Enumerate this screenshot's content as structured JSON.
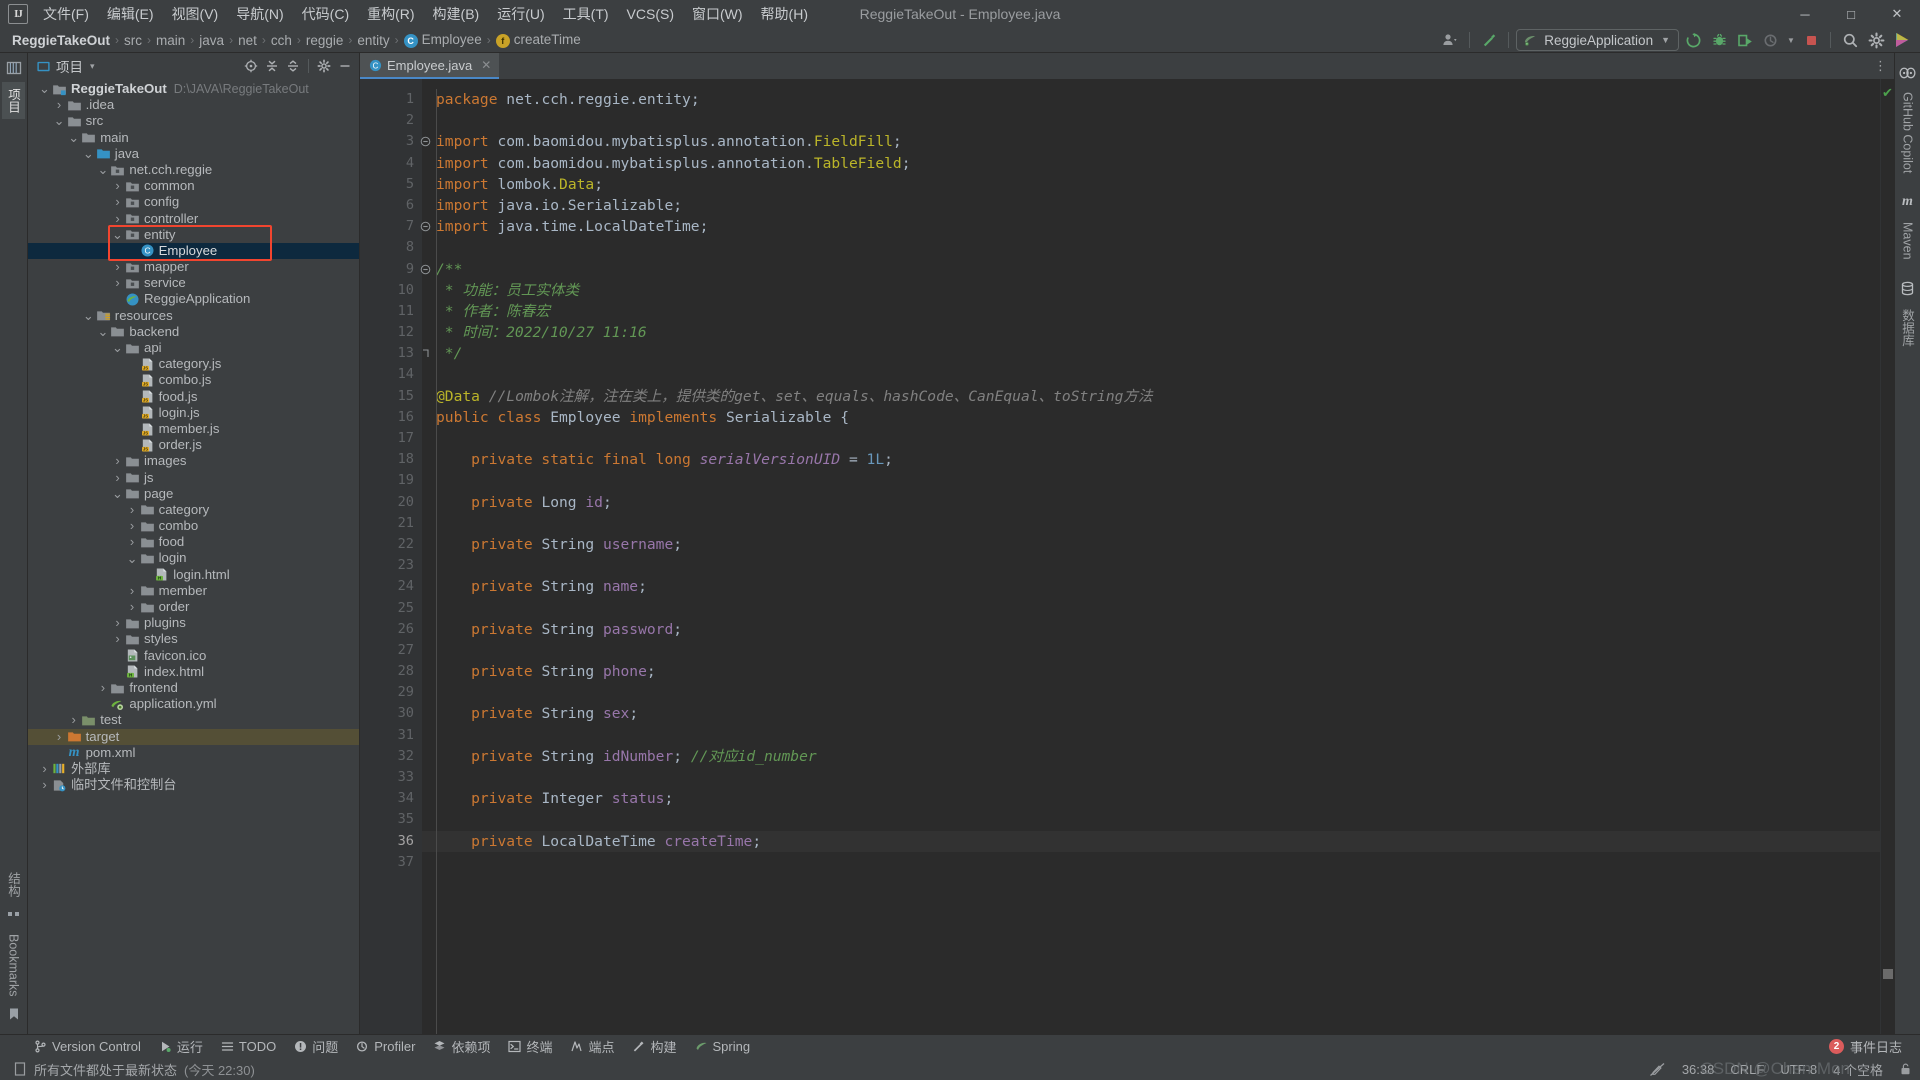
{
  "window": {
    "title": "ReggieTakeOut - Employee.java",
    "logo": "intellij-idea-logo",
    "minimize": "─",
    "maximize": "□",
    "close": "✕"
  },
  "menubar": {
    "items": [
      {
        "label": "文件(F)"
      },
      {
        "label": "编辑(E)"
      },
      {
        "label": "视图(V)"
      },
      {
        "label": "导航(N)"
      },
      {
        "label": "代码(C)"
      },
      {
        "label": "重构(R)"
      },
      {
        "label": "构建(B)"
      },
      {
        "label": "运行(U)"
      },
      {
        "label": "工具(T)"
      },
      {
        "label": "VCS(S)"
      },
      {
        "label": "窗口(W)"
      },
      {
        "label": "帮助(H)"
      }
    ]
  },
  "breadcrumb": {
    "items": [
      {
        "label": "ReggieTakeOut",
        "bold": true,
        "icon": null
      },
      {
        "label": "src",
        "bold": false,
        "icon": null
      },
      {
        "label": "main",
        "bold": false,
        "icon": null
      },
      {
        "label": "java",
        "bold": false,
        "icon": null
      },
      {
        "label": "net",
        "bold": false,
        "icon": null
      },
      {
        "label": "cch",
        "bold": false,
        "icon": null
      },
      {
        "label": "reggie",
        "bold": false,
        "icon": null
      },
      {
        "label": "entity",
        "bold": false,
        "icon": null
      },
      {
        "label": "Employee",
        "bold": false,
        "icon": "class-icon",
        "glyph": "C"
      },
      {
        "label": "createTime",
        "bold": false,
        "icon": "field-icon",
        "glyph": "f"
      }
    ],
    "separator": "›"
  },
  "toolbar": {
    "account_icon": "user-account-icon",
    "hammer_icon": "build-hammer-icon",
    "run_config": "ReggieApplication",
    "run_config_icon": "spring-boot-icon",
    "rerun_icon": "rerun-icon",
    "debug_icon": "debug-bug-icon",
    "run_with_coverage_icon": "run-coverage-icon",
    "profile_icon": "profiler-icon",
    "stop_icon": "stop-icon",
    "search_icon": "search-everywhere-icon",
    "settings_icon": "settings-gear-icon",
    "updates_icon": "ide-updates-icon"
  },
  "left_rail": {
    "project_tab": "项目",
    "structure_tab": "结构",
    "bookmarks_tab": "Bookmarks"
  },
  "right_rail": {
    "tabs": [
      {
        "label": "GitHub Copilot",
        "icon": "copilot-icon"
      },
      {
        "label": "Maven",
        "icon": "maven-m-icon"
      },
      {
        "label": "数据库",
        "icon": "database-icon"
      }
    ]
  },
  "project_panel": {
    "title": "项目",
    "caret": "▾",
    "icons": {
      "select_opened_file": "crosshair-target-icon",
      "expand_all": "expand-all-icon",
      "collapse_all": "collapse-all-icon",
      "settings": "gear-icon",
      "hide": "minimize-icon"
    },
    "tree": [
      {
        "depth": 0,
        "arrow": "open",
        "icon": "module-folder",
        "label": "ReggieTakeOut",
        "bold": true,
        "path": "D:\\JAVA\\ReggieTakeOut"
      },
      {
        "depth": 1,
        "arrow": "closed",
        "icon": "folder",
        "label": ".idea"
      },
      {
        "depth": 1,
        "arrow": "open",
        "icon": "folder",
        "label": "src"
      },
      {
        "depth": 2,
        "arrow": "open",
        "icon": "folder",
        "label": "main"
      },
      {
        "depth": 3,
        "arrow": "open",
        "icon": "source-folder",
        "label": "java"
      },
      {
        "depth": 4,
        "arrow": "open",
        "icon": "package",
        "label": "net.cch.reggie"
      },
      {
        "depth": 5,
        "arrow": "closed",
        "icon": "package",
        "label": "common"
      },
      {
        "depth": 5,
        "arrow": "closed",
        "icon": "package",
        "label": "config"
      },
      {
        "depth": 5,
        "arrow": "closed",
        "icon": "package",
        "label": "controller"
      },
      {
        "depth": 5,
        "arrow": "open",
        "icon": "package",
        "label": "entity"
      },
      {
        "depth": 6,
        "arrow": "none",
        "icon": "java-class",
        "label": "Employee",
        "selected": true
      },
      {
        "depth": 5,
        "arrow": "closed",
        "icon": "package",
        "label": "mapper"
      },
      {
        "depth": 5,
        "arrow": "closed",
        "icon": "package",
        "label": "service"
      },
      {
        "depth": 5,
        "arrow": "none",
        "icon": "spring-class",
        "label": "ReggieApplication"
      },
      {
        "depth": 3,
        "arrow": "open",
        "icon": "resources-folder",
        "label": "resources"
      },
      {
        "depth": 4,
        "arrow": "open",
        "icon": "folder",
        "label": "backend"
      },
      {
        "depth": 5,
        "arrow": "open",
        "icon": "folder",
        "label": "api"
      },
      {
        "depth": 6,
        "arrow": "none",
        "icon": "js-file",
        "label": "category.js"
      },
      {
        "depth": 6,
        "arrow": "none",
        "icon": "js-file",
        "label": "combo.js"
      },
      {
        "depth": 6,
        "arrow": "none",
        "icon": "js-file",
        "label": "food.js"
      },
      {
        "depth": 6,
        "arrow": "none",
        "icon": "js-file",
        "label": "login.js"
      },
      {
        "depth": 6,
        "arrow": "none",
        "icon": "js-file",
        "label": "member.js"
      },
      {
        "depth": 6,
        "arrow": "none",
        "icon": "js-file",
        "label": "order.js"
      },
      {
        "depth": 5,
        "arrow": "closed",
        "icon": "folder",
        "label": "images"
      },
      {
        "depth": 5,
        "arrow": "closed",
        "icon": "folder",
        "label": "js"
      },
      {
        "depth": 5,
        "arrow": "open",
        "icon": "folder",
        "label": "page"
      },
      {
        "depth": 6,
        "arrow": "closed",
        "icon": "folder",
        "label": "category"
      },
      {
        "depth": 6,
        "arrow": "closed",
        "icon": "folder",
        "label": "combo"
      },
      {
        "depth": 6,
        "arrow": "closed",
        "icon": "folder",
        "label": "food"
      },
      {
        "depth": 6,
        "arrow": "open",
        "icon": "folder",
        "label": "login"
      },
      {
        "depth": 7,
        "arrow": "none",
        "icon": "html-file",
        "label": "login.html"
      },
      {
        "depth": 6,
        "arrow": "closed",
        "icon": "folder",
        "label": "member"
      },
      {
        "depth": 6,
        "arrow": "closed",
        "icon": "folder",
        "label": "order"
      },
      {
        "depth": 5,
        "arrow": "closed",
        "icon": "folder",
        "label": "plugins"
      },
      {
        "depth": 5,
        "arrow": "closed",
        "icon": "folder",
        "label": "styles"
      },
      {
        "depth": 5,
        "arrow": "none",
        "icon": "image-file",
        "label": "favicon.ico"
      },
      {
        "depth": 5,
        "arrow": "none",
        "icon": "html-file",
        "label": "index.html"
      },
      {
        "depth": 4,
        "arrow": "closed",
        "icon": "folder",
        "label": "frontend"
      },
      {
        "depth": 4,
        "arrow": "none",
        "icon": "spring-yml",
        "label": "application.yml"
      },
      {
        "depth": 2,
        "arrow": "closed",
        "icon": "test-folder",
        "label": "test"
      },
      {
        "depth": 1,
        "arrow": "closed",
        "icon": "excluded-folder",
        "label": "target",
        "highlighted": true
      },
      {
        "depth": 1,
        "arrow": "none",
        "icon": "maven-file",
        "label": "pom.xml"
      },
      {
        "depth": 0,
        "arrow": "closed",
        "icon": "external-libraries",
        "label": "外部库"
      },
      {
        "depth": 0,
        "arrow": "closed",
        "icon": "scratches",
        "label": "临时文件和控制台"
      }
    ]
  },
  "editor": {
    "tab": {
      "label": "Employee.java",
      "icon": "java-class-icon",
      "close": "✕"
    },
    "kebab": "⋮",
    "inspection_status": "✔",
    "lines": [
      {
        "n": 1,
        "tokens": [
          {
            "t": "package ",
            "c": "kw"
          },
          {
            "t": "net.cch.reggie.entity",
            "c": "pnct"
          },
          {
            "t": ";",
            "c": "pnct"
          }
        ]
      },
      {
        "n": 2,
        "tokens": []
      },
      {
        "n": 3,
        "fold": "-",
        "tokens": [
          {
            "t": "import ",
            "c": "kw"
          },
          {
            "t": "com.baomidou.mybatisplus.annotation.",
            "c": "pnct"
          },
          {
            "t": "FieldFill",
            "c": "ylw"
          },
          {
            "t": ";",
            "c": "pnct"
          }
        ]
      },
      {
        "n": 4,
        "tokens": [
          {
            "t": "import ",
            "c": "kw"
          },
          {
            "t": "com.baomidou.mybatisplus.annotation.",
            "c": "pnct"
          },
          {
            "t": "TableField",
            "c": "ylw"
          },
          {
            "t": ";",
            "c": "pnct"
          }
        ]
      },
      {
        "n": 5,
        "tokens": [
          {
            "t": "import ",
            "c": "kw"
          },
          {
            "t": "lombok.",
            "c": "pnct"
          },
          {
            "t": "Data",
            "c": "ylw"
          },
          {
            "t": ";",
            "c": "pnct"
          }
        ]
      },
      {
        "n": 6,
        "tokens": [
          {
            "t": "import ",
            "c": "kw"
          },
          {
            "t": "java.io.Serializable",
            "c": "pnct"
          },
          {
            "t": ";",
            "c": "pnct"
          }
        ]
      },
      {
        "n": 7,
        "fold": "-",
        "tokens": [
          {
            "t": "import ",
            "c": "kw"
          },
          {
            "t": "java.time.LocalDateTime",
            "c": "pnct"
          },
          {
            "t": ";",
            "c": "pnct"
          }
        ]
      },
      {
        "n": 8,
        "tokens": []
      },
      {
        "n": 9,
        "fold": "-",
        "tokens": [
          {
            "t": "/**",
            "c": "cmt"
          }
        ]
      },
      {
        "n": 10,
        "tokens": [
          {
            "t": " * 功能：员工实体类",
            "c": "cmt"
          }
        ]
      },
      {
        "n": 11,
        "tokens": [
          {
            "t": " * 作者：陈春宏",
            "c": "cmt"
          }
        ]
      },
      {
        "n": 12,
        "tokens": [
          {
            "t": " * 时间：2022/10/27 11:16",
            "c": "cmt"
          }
        ]
      },
      {
        "n": 13,
        "fold": "end",
        "tokens": [
          {
            "t": " */",
            "c": "cmt"
          }
        ]
      },
      {
        "n": 14,
        "tokens": []
      },
      {
        "n": 15,
        "tokens": [
          {
            "t": "@Data",
            "c": "ann"
          },
          {
            "t": " //Lombok注解，注在类上，提供类的get、set、equals、hashCode、CanEqual、toString方法",
            "c": "cmt2"
          }
        ]
      },
      {
        "n": 16,
        "tokens": [
          {
            "t": "public ",
            "c": "kw"
          },
          {
            "t": "class ",
            "c": "kw"
          },
          {
            "t": "Employee ",
            "c": "cls"
          },
          {
            "t": "implements ",
            "c": "kw"
          },
          {
            "t": "Serializable",
            "c": "cls"
          },
          {
            "t": " {",
            "c": "pnct"
          }
        ]
      },
      {
        "n": 17,
        "tokens": []
      },
      {
        "n": 18,
        "tokens": [
          {
            "t": "    private static final ",
            "c": "kw"
          },
          {
            "t": "long ",
            "c": "kw"
          },
          {
            "t": "serialVersionUID",
            "c": "stat"
          },
          {
            "t": " = ",
            "c": "pnct"
          },
          {
            "t": "1L",
            "c": "num"
          },
          {
            "t": ";",
            "c": "pnct"
          }
        ]
      },
      {
        "n": 19,
        "tokens": []
      },
      {
        "n": 20,
        "tokens": [
          {
            "t": "    private ",
            "c": "kw"
          },
          {
            "t": "Long ",
            "c": "cls"
          },
          {
            "t": "id",
            "c": "fld"
          },
          {
            "t": ";",
            "c": "pnct"
          }
        ]
      },
      {
        "n": 21,
        "tokens": []
      },
      {
        "n": 22,
        "tokens": [
          {
            "t": "    private ",
            "c": "kw"
          },
          {
            "t": "String ",
            "c": "cls"
          },
          {
            "t": "username",
            "c": "fld"
          },
          {
            "t": ";",
            "c": "pnct"
          }
        ]
      },
      {
        "n": 23,
        "tokens": []
      },
      {
        "n": 24,
        "tokens": [
          {
            "t": "    private ",
            "c": "kw"
          },
          {
            "t": "String ",
            "c": "cls"
          },
          {
            "t": "name",
            "c": "fld"
          },
          {
            "t": ";",
            "c": "pnct"
          }
        ]
      },
      {
        "n": 25,
        "tokens": []
      },
      {
        "n": 26,
        "tokens": [
          {
            "t": "    private ",
            "c": "kw"
          },
          {
            "t": "String ",
            "c": "cls"
          },
          {
            "t": "password",
            "c": "fld"
          },
          {
            "t": ";",
            "c": "pnct"
          }
        ]
      },
      {
        "n": 27,
        "tokens": []
      },
      {
        "n": 28,
        "tokens": [
          {
            "t": "    private ",
            "c": "kw"
          },
          {
            "t": "String ",
            "c": "cls"
          },
          {
            "t": "phone",
            "c": "fld"
          },
          {
            "t": ";",
            "c": "pnct"
          }
        ]
      },
      {
        "n": 29,
        "tokens": []
      },
      {
        "n": 30,
        "tokens": [
          {
            "t": "    private ",
            "c": "kw"
          },
          {
            "t": "String ",
            "c": "cls"
          },
          {
            "t": "sex",
            "c": "fld"
          },
          {
            "t": ";",
            "c": "pnct"
          }
        ]
      },
      {
        "n": 31,
        "tokens": []
      },
      {
        "n": 32,
        "tokens": [
          {
            "t": "    private ",
            "c": "kw"
          },
          {
            "t": "String ",
            "c": "cls"
          },
          {
            "t": "idNumber",
            "c": "fld"
          },
          {
            "t": "; ",
            "c": "pnct"
          },
          {
            "t": "//对应id_number",
            "c": "cmt"
          }
        ]
      },
      {
        "n": 33,
        "tokens": []
      },
      {
        "n": 34,
        "tokens": [
          {
            "t": "    private ",
            "c": "kw"
          },
          {
            "t": "Integer ",
            "c": "cls"
          },
          {
            "t": "status",
            "c": "fld"
          },
          {
            "t": ";",
            "c": "pnct"
          }
        ]
      },
      {
        "n": 35,
        "tokens": []
      },
      {
        "n": 36,
        "tokens": [
          {
            "t": "    private ",
            "c": "kw"
          },
          {
            "t": "LocalDateTime ",
            "c": "cls"
          },
          {
            "t": "createTime",
            "c": "fld"
          },
          {
            "t": ";",
            "c": "pnct"
          }
        ],
        "current": true
      },
      {
        "n": 37,
        "tokens": []
      }
    ]
  },
  "tool_windows": {
    "items": [
      {
        "label": "Version Control",
        "icon": "branch-icon"
      },
      {
        "label": "运行",
        "icon": "run-play-icon"
      },
      {
        "label": "TODO",
        "icon": "todo-list-icon"
      },
      {
        "label": "问题",
        "icon": "problems-icon"
      },
      {
        "label": "Profiler",
        "icon": "profiler-icon"
      },
      {
        "label": "依赖项",
        "icon": "dependencies-icon"
      },
      {
        "label": "终端",
        "icon": "terminal-icon"
      },
      {
        "label": "端点",
        "icon": "endpoints-icon"
      },
      {
        "label": "构建",
        "icon": "build-hammer-icon"
      },
      {
        "label": "Spring",
        "icon": "spring-leaf-icon"
      }
    ],
    "event_log": {
      "label": "事件日志",
      "count": "2"
    }
  },
  "statusbar": {
    "vcs_icon": "file-status-icon",
    "message": "所有文件都处于最新状态",
    "message_time": "(今天 22:30)",
    "no_read_only_icon": "no-edit-icon",
    "caret": "36:38",
    "line_separator": "CRLF",
    "encoding": "UTF-8",
    "indent": "4 个空格",
    "lock_icon": "unlocked-icon"
  },
  "watermark": "CSDN @Chen-Mon"
}
